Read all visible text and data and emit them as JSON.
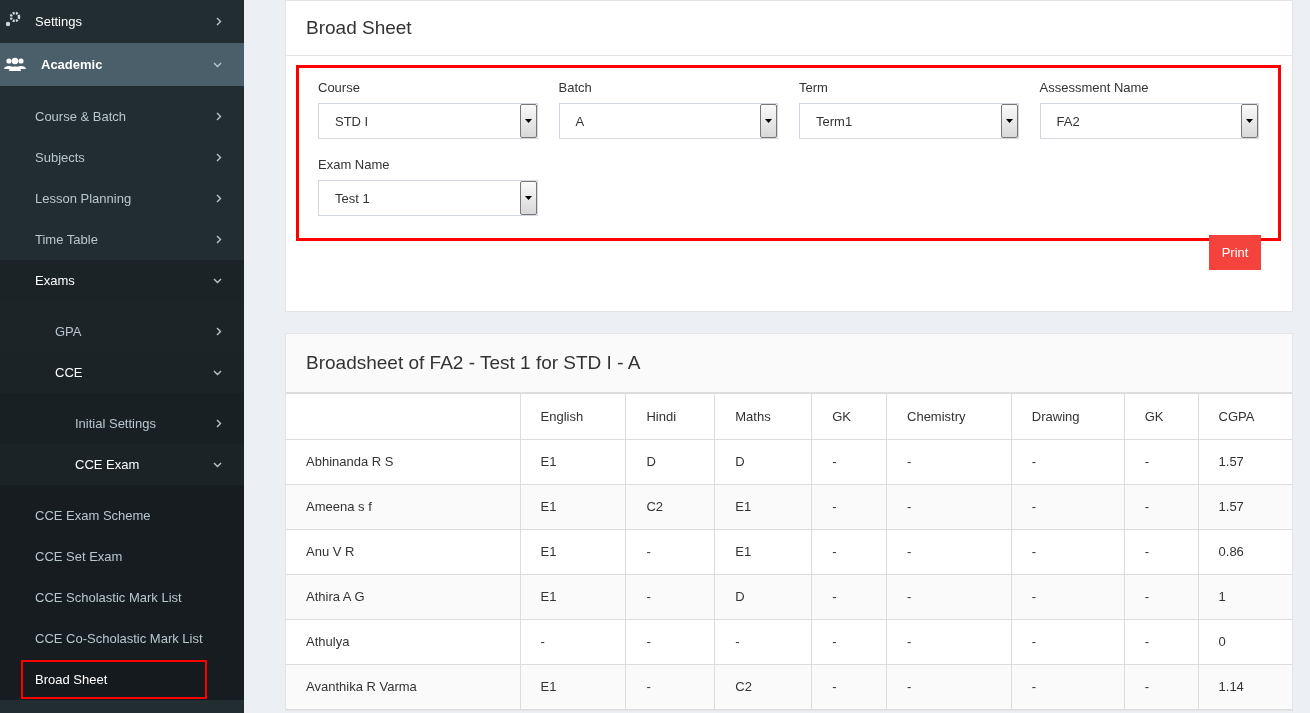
{
  "sidebar": {
    "items": [
      {
        "label": "Settings",
        "expanded": false,
        "selected": false
      },
      {
        "label": "Academic",
        "expanded": true,
        "selected": true,
        "children": [
          {
            "label": "Course & Batch",
            "expanded": false
          },
          {
            "label": "Subjects",
            "expanded": false
          },
          {
            "label": "Lesson Planning",
            "expanded": false
          },
          {
            "label": "Time Table",
            "expanded": false
          },
          {
            "label": "Exams",
            "expanded": true,
            "children": [
              {
                "label": "GPA",
                "expanded": false
              },
              {
                "label": "CCE",
                "expanded": true,
                "children": [
                  {
                    "label": "Initial Settings",
                    "expanded": false
                  },
                  {
                    "label": "CCE Exam",
                    "expanded": true,
                    "children": [
                      {
                        "label": "CCE Exam Scheme",
                        "selected": false
                      },
                      {
                        "label": "CCE Set Exam",
                        "selected": false
                      },
                      {
                        "label": "CCE Scholastic Mark List",
                        "selected": false
                      },
                      {
                        "label": "CCE Co-Scholastic Mark List",
                        "selected": false
                      },
                      {
                        "label": "Broad Sheet",
                        "selected": true
                      }
                    ]
                  }
                ]
              }
            ]
          }
        ]
      }
    ]
  },
  "filter_card": {
    "title": "Broad Sheet",
    "highlighted": true,
    "fields": [
      {
        "label": "Course",
        "value": "STD I"
      },
      {
        "label": "Batch",
        "value": "A"
      },
      {
        "label": "Term",
        "value": "Term1"
      },
      {
        "label": "Assessment Name",
        "value": "FA2"
      },
      {
        "label": "Exam Name",
        "value": "Test 1"
      }
    ],
    "print_button": "Print"
  },
  "table_card": {
    "title": "Broadsheet of FA2 - Test 1 for STD I - A",
    "columns": [
      "",
      "English",
      "Hindi",
      "Maths",
      "GK",
      "Chemistry",
      "Drawing",
      "GK",
      "CGPA"
    ],
    "rows": [
      [
        "Abhinanda R S",
        "E1",
        "D",
        "D",
        "-",
        "-",
        "-",
        "-",
        "1.57"
      ],
      [
        "Ameena s f",
        "E1",
        "C2",
        "E1",
        "-",
        "-",
        "-",
        "-",
        "1.57"
      ],
      [
        "Anu V R",
        "E1",
        "-",
        "E1",
        "-",
        "-",
        "-",
        "-",
        "0.86"
      ],
      [
        "Athira A G",
        "E1",
        "-",
        "D",
        "-",
        "-",
        "-",
        "-",
        "1"
      ],
      [
        "Athulya",
        "-",
        "-",
        "-",
        "-",
        "-",
        "-",
        "-",
        "0"
      ],
      [
        "Avanthika R Varma",
        "E1",
        "-",
        "C2",
        "-",
        "-",
        "-",
        "-",
        "1.14"
      ]
    ]
  }
}
